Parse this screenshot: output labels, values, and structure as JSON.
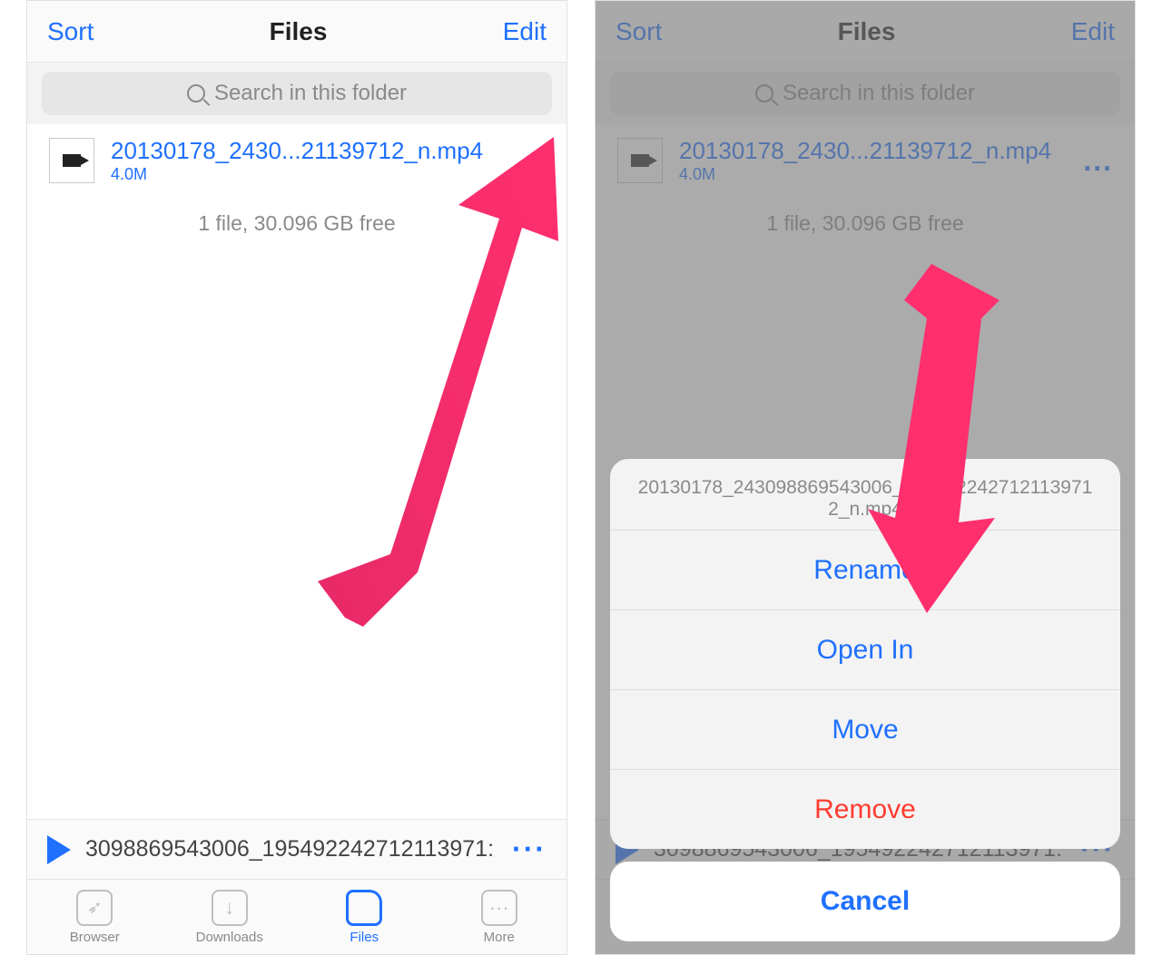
{
  "nav": {
    "left": "Sort",
    "title": "Files",
    "right": "Edit"
  },
  "search": {
    "placeholder": "Search in this folder"
  },
  "file": {
    "name": "20130178_2430...21139712_n.mp4",
    "size": "4.0M"
  },
  "status": "1 file, 30.096 GB free",
  "player": {
    "text": "3098869543006_195492242712113971:"
  },
  "tabs": {
    "browser": "Browser",
    "downloads": "Downloads",
    "files": "Files",
    "more": "More"
  },
  "sheet": {
    "filename": "20130178_243098869543006_1954922427121139712_n.mp4",
    "rename": "Rename",
    "openin": "Open In",
    "move": "Move",
    "remove": "Remove",
    "cancel": "Cancel"
  }
}
